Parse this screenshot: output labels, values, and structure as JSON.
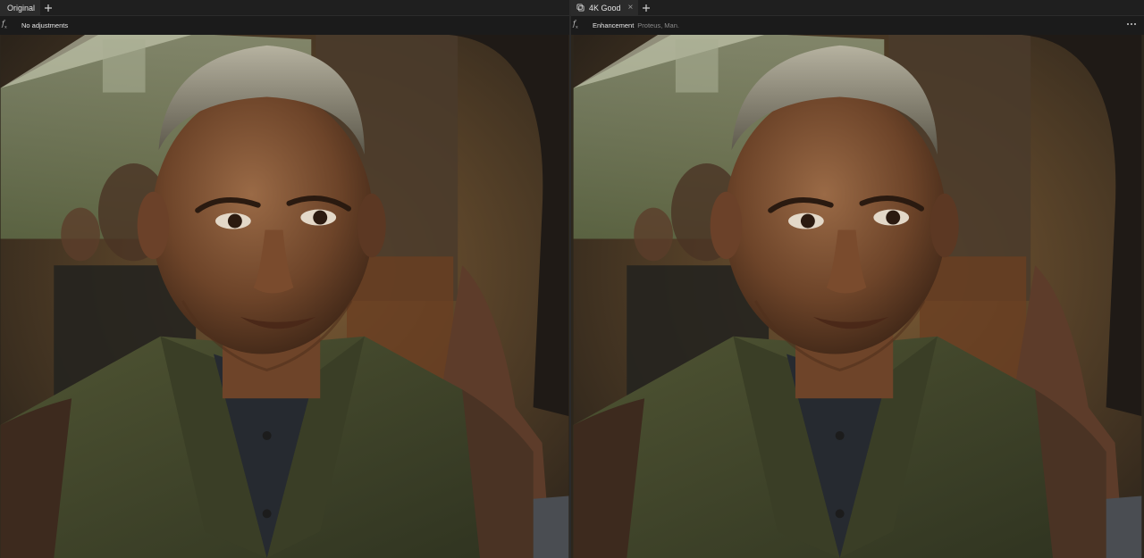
{
  "left_panel": {
    "tab_label": "Original",
    "add_tab_icon": "plus-icon",
    "adjustments_label": "No adjustments"
  },
  "right_panel": {
    "tab_label": "4K Good",
    "tab_icon": "preset-icon",
    "close_icon": "close-icon",
    "add_tab_icon": "plus-icon",
    "enhancement_label": "Enhancement",
    "enhancement_detail": "Proteus, Man.",
    "more_icon": "more-icon"
  },
  "fx_icon": "fx-icon"
}
